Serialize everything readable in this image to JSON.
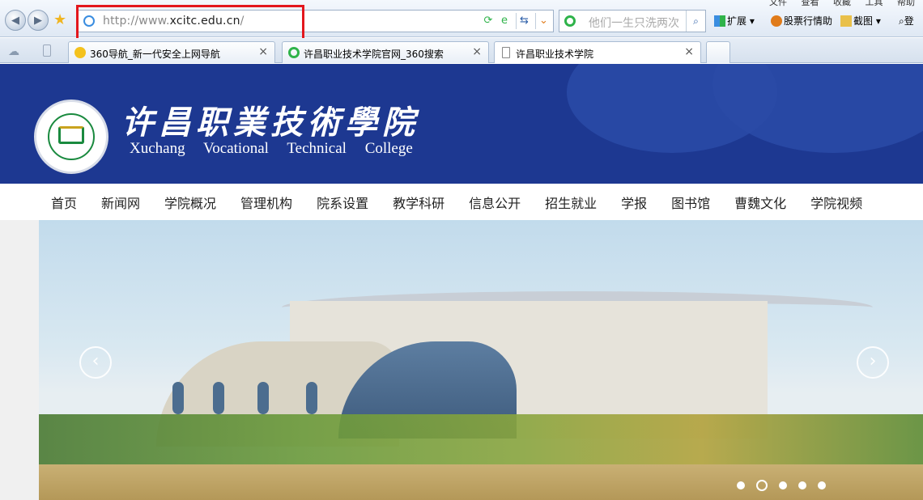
{
  "browser": {
    "menu": [
      "文件",
      "查看",
      "收藏",
      "工具",
      "帮助"
    ],
    "address": {
      "prefix": "http://www.",
      "domain": "xcitc.edu.cn",
      "suffix": "/"
    },
    "search_placeholder": "他们一生只洗两次",
    "tools": {
      "extend": "扩展",
      "stock": "股票行情助",
      "screenshot": "截图",
      "login": "登"
    },
    "tabs": [
      {
        "label": "360导航_新一代安全上网导航",
        "active": false
      },
      {
        "label": "许昌职业技术学院官网_360搜索",
        "active": false
      },
      {
        "label": "许昌职业技术学院",
        "active": true
      }
    ],
    "icons": {
      "highlight_color": "#e3171d"
    }
  },
  "site": {
    "title_cn": "许昌职業技術學院",
    "title_en": [
      "Xuchang",
      "Vocational",
      "Technical",
      "College"
    ],
    "header_color": "#1d3891",
    "nav": [
      "首页",
      "新闻网",
      "学院概况",
      "管理机构",
      "院系设置",
      "教学科研",
      "信息公开",
      "招生就业",
      "学报",
      "图书馆",
      "曹魏文化",
      "学院视频"
    ],
    "slider": {
      "slides": 5,
      "active_index": 1
    }
  }
}
